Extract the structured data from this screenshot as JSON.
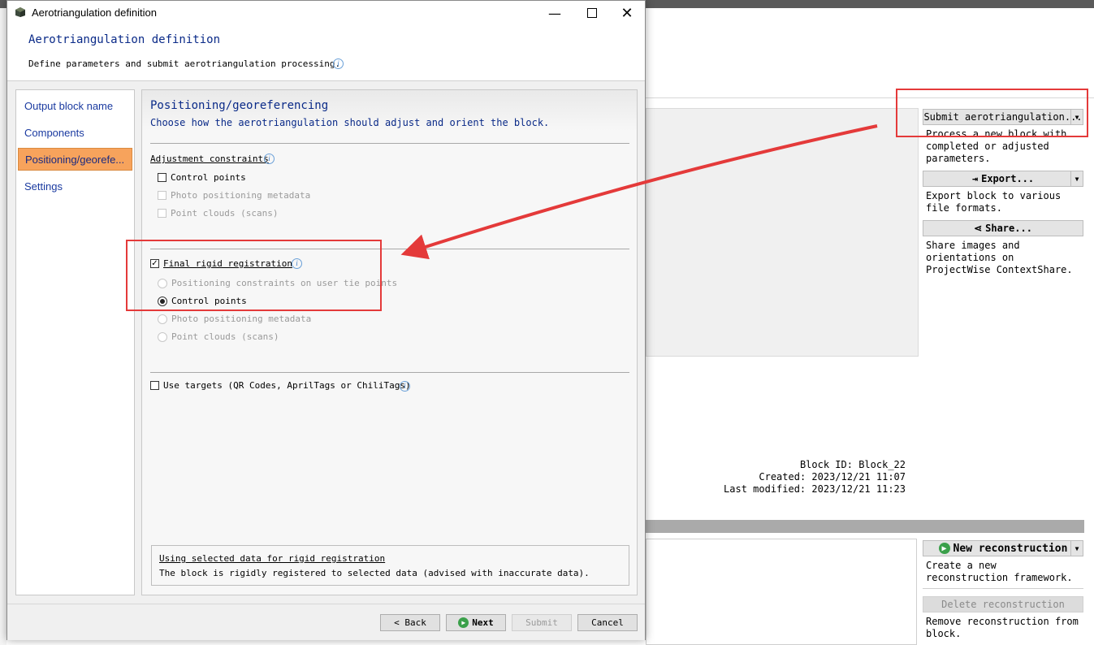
{
  "dialog": {
    "window_title": "Aerotriangulation definition",
    "header_title": "Aerotriangulation definition",
    "header_desc": "Define parameters and submit aerotriangulation processing.",
    "nav": [
      {
        "label": "Output block name"
      },
      {
        "label": "Components"
      },
      {
        "label": "Positioning/georefe..."
      },
      {
        "label": "Settings"
      }
    ],
    "active_nav_index": 2,
    "panel": {
      "title": "Positioning/georeferencing",
      "subtitle": "Choose how the aerotriangulation should adjust and orient the block.",
      "adjustment": {
        "label": "Adjustment constraints",
        "options": [
          {
            "label": "Control points",
            "checked": false,
            "enabled": true
          },
          {
            "label": "Photo positioning metadata",
            "checked": false,
            "enabled": false
          },
          {
            "label": "Point clouds (scans)",
            "checked": false,
            "enabled": false
          }
        ]
      },
      "rigid": {
        "label": "Final rigid registration",
        "checked": true,
        "options": [
          {
            "label": "Positioning constraints on user tie points",
            "selected": false,
            "enabled": false
          },
          {
            "label": "Control points",
            "selected": true,
            "enabled": true
          },
          {
            "label": "Photo positioning metadata",
            "selected": false,
            "enabled": false
          },
          {
            "label": "Point clouds (scans)",
            "selected": false,
            "enabled": false
          }
        ]
      },
      "targets": {
        "label": "Use targets (QR Codes, AprilTags or ChiliTags)",
        "checked": false
      },
      "info_box": {
        "title": "Using selected data for rigid registration",
        "text": "The block is rigidly registered to selected data (advised with inaccurate data)."
      }
    },
    "buttons": {
      "back": "< Back",
      "next": "Next",
      "submit": "Submit",
      "cancel": "Cancel"
    }
  },
  "background": {
    "submit_btn": "Submit aerotriangulation...",
    "submit_desc": "Process a new block with completed or adjusted parameters.",
    "export_btn": "Export...",
    "export_desc": "Export block to various file formats.",
    "share_btn": "Share...",
    "share_desc": "Share images and orientations on ProjectWise ContextShare.",
    "block_id_label": "Block ID:",
    "block_id": "Block_22",
    "created_label": "Created:",
    "created": "2023/12/21 11:07",
    "modified_label": "Last modified:",
    "modified": "2023/12/21 11:23",
    "new_recon_btn": "New reconstruction",
    "new_recon_desc": "Create a new reconstruction framework.",
    "delete_recon_btn": "Delete reconstruction",
    "delete_recon_desc": "Remove reconstruction from block."
  },
  "colors": {
    "accent": "#f7a35c",
    "title_blue": "#0a2a88",
    "annotation_red": "#e43a3a"
  }
}
